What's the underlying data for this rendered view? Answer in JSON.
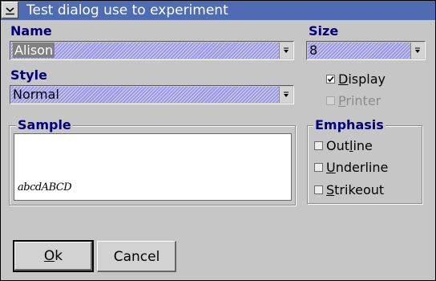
{
  "window": {
    "title": "Test dialog use to experiment",
    "system_menu_icon": "system-menu-icon"
  },
  "name": {
    "label": "Name",
    "value": "Alison"
  },
  "size": {
    "label": "Size",
    "value": "8"
  },
  "style": {
    "label": "Style",
    "value": "Normal"
  },
  "display": {
    "label_pre": "",
    "label_u": "D",
    "label_post": "isplay",
    "checked": true
  },
  "printer": {
    "label_pre": "",
    "label_u": "P",
    "label_post": "rinter",
    "checked": false,
    "disabled": true
  },
  "sample": {
    "label": "Sample",
    "text": "abcdABCD"
  },
  "emphasis": {
    "label": "Emphasis",
    "outline": {
      "label_pre": "Out",
      "label_u": "l",
      "label_post": "ine",
      "checked": false
    },
    "underline": {
      "label_pre": "",
      "label_u": "U",
      "label_post": "nderline",
      "checked": false
    },
    "strikeout": {
      "label_pre": "",
      "label_u": "S",
      "label_post": "trikeout",
      "checked": false
    }
  },
  "buttons": {
    "ok": {
      "label_u": "O",
      "label_post": "k"
    },
    "cancel": {
      "label": "Cancel"
    }
  },
  "colors": {
    "titlebar": "#4f6cb2",
    "label_text": "#00007c",
    "combo_fill": "#9c9ae6",
    "dialog_bg": "#c6c6c6"
  }
}
